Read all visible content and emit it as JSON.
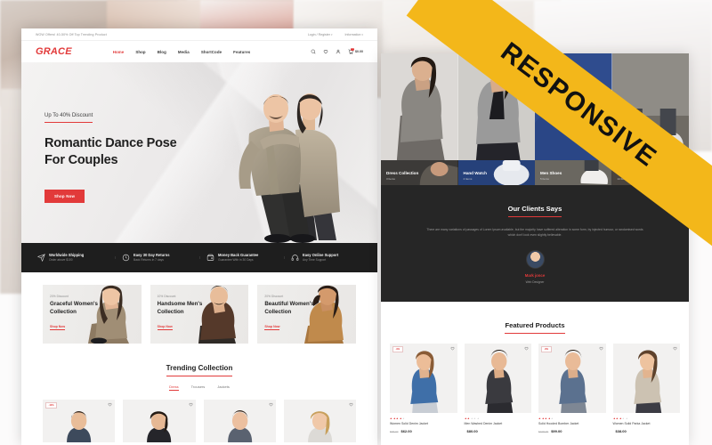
{
  "ribbon": {
    "label": "RESPONSIVE",
    "color": "#f3b71a"
  },
  "theme": {
    "accent": "#e23a3a",
    "dark": "#1e1e1e",
    "darker": "#262626"
  },
  "desktop": {
    "topbar": {
      "promo": "WOW Offers! 40-50% Off Top Trending Product",
      "login": "Login / Register",
      "information": "Information",
      "caret": "▾"
    },
    "header": {
      "logo": "GRACE",
      "nav": [
        {
          "label": "Home",
          "active": true
        },
        {
          "label": "Shop",
          "active": false
        },
        {
          "label": "Blog",
          "active": false
        },
        {
          "label": "Media",
          "active": false
        },
        {
          "label": "ShortCode",
          "active": false
        },
        {
          "label": "Features",
          "active": false
        }
      ],
      "icons": [
        "search-icon",
        "wishlist-icon",
        "account-icon",
        "cart-icon"
      ],
      "cart_count": "0",
      "cart_total": "$0.00"
    },
    "hero": {
      "eyebrow": "Up To 40% Discount",
      "title_line1": "Romantic Dance Pose",
      "title_line2": "For Couples",
      "cta": "Shop Now"
    },
    "features": [
      {
        "icon": "shipping-icon",
        "title": "Worldwide Shipping",
        "subtitle": "Order above $100"
      },
      {
        "icon": "returns-icon",
        "title": "Easy 30 Day Returns",
        "subtitle": "Back Returns in 7 days"
      },
      {
        "icon": "wallet-icon",
        "title": "Money Back Guarantee",
        "subtitle": "Guarantee With in 30 Days"
      },
      {
        "icon": "headset-icon",
        "title": "Easy Online Support",
        "subtitle": "Any Time Support"
      }
    ],
    "collections": [
      {
        "discount": "20% Discount",
        "title_line1": "Graceful Women's",
        "title_line2": "Collection",
        "cta": "Shop Now"
      },
      {
        "discount": "10% Discount",
        "title_line1": "Handsome Men's",
        "title_line2": "Collection",
        "cta": "Shop Now"
      },
      {
        "discount": "20% Discount",
        "title_line1": "Beautiful Women's",
        "title_line2": "Collection",
        "cta": "Shop Now"
      }
    ],
    "trending": {
      "title": "Trending Collection",
      "tabs": [
        {
          "label": "Dress",
          "active": true
        },
        {
          "label": "Trousers",
          "active": false
        },
        {
          "label": "Jackets",
          "active": false
        }
      ],
      "products": [
        {
          "badge": "-10%",
          "wishlist": "heart-icon"
        },
        {
          "badge": "",
          "wishlist": "heart-icon"
        },
        {
          "badge": "",
          "wishlist": "heart-icon"
        },
        {
          "badge": "",
          "wishlist": "heart-icon"
        }
      ]
    }
  },
  "responsive_view": {
    "categories": [
      {
        "name": "Dress Collection",
        "count": "3 Items"
      },
      {
        "name": "Hand Watch",
        "count": "4 Items"
      },
      {
        "name": "Men Shoes",
        "count": "5 Items"
      },
      {
        "name": "Purse",
        "count": "14 Items"
      }
    ],
    "clients": {
      "title": "Our Clients Says",
      "body": "There are many variations of passages of Lorem Ipsum available, but the majority have suffered alteration in some form, by injected humour, or randomised words which don't look even slightly believable.",
      "name": "Mark jonce",
      "role": "Web Designer"
    },
    "featured": {
      "title": "Featured Products",
      "products": [
        {
          "badge": "-9%",
          "name": "Women Solid Denim Jacket",
          "old_price": "$68.00",
          "price": "$62.00",
          "rating": 4,
          "wishlist": "heart-icon"
        },
        {
          "badge": "",
          "name": "Men Washed Denim Jacket",
          "old_price": "",
          "price": "$80.00",
          "rating": 2,
          "wishlist": "heart-icon"
        },
        {
          "badge": "-8%",
          "name": "Solid Hooded Bomber Jacket",
          "old_price": "$108.00",
          "price": "$99.00",
          "rating": 4,
          "wishlist": "heart-icon"
        },
        {
          "badge": "",
          "name": "Women Solid Parka Jacket",
          "old_price": "",
          "price": "$38.00",
          "rating": 3,
          "wishlist": "heart-icon"
        }
      ]
    }
  }
}
